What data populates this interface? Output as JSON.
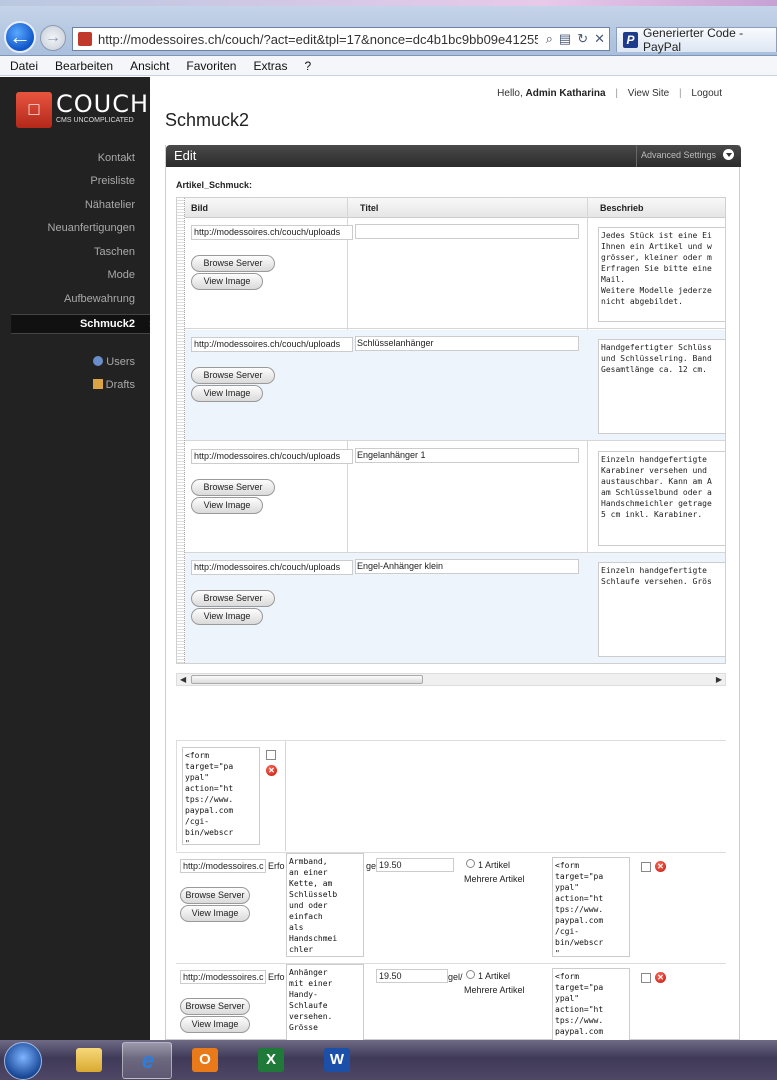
{
  "browser": {
    "url": "http://modessoires.ch/couch/?act=edit&tpl=17&nonce=dc4b1bc9bb09e41255a06",
    "tab_title": "Generierter Code - PayPal",
    "menu": [
      "Datei",
      "Bearbeiten",
      "Ansicht",
      "Favoriten",
      "Extras",
      "?"
    ]
  },
  "logo": {
    "word": "COUCH",
    "tagline": "CMS UNCOMPLICATED"
  },
  "header": {
    "hello_prefix": "Hello,",
    "user": "Admin Katharina",
    "view_site": "View Site",
    "logout": "Logout"
  },
  "sidebar": {
    "items": [
      "Kontakt",
      "Preisliste",
      "Nähatelier",
      "Neuanfertigungen",
      "Taschen",
      "Mode",
      "Aufbewahrung"
    ],
    "active": "Schmuck2",
    "admin": [
      "Users",
      "Drafts"
    ]
  },
  "page": {
    "title": "Schmuck2",
    "panel_label": "Edit",
    "advanced_settings": "Advanced Settings",
    "field_label": "Artikel_Schmuck:"
  },
  "table": {
    "columns": [
      "Bild",
      "Titel",
      "Beschrieb"
    ],
    "browse_label": "Browse Server",
    "view_label": "View Image",
    "rows": [
      {
        "url": "http://modessoires.ch/couch/uploads",
        "title": "",
        "desc": "Jedes Stück ist eine Ei\nIhnen ein Artikel und w\ngrösser, kleiner oder m\nErfragen Sie bitte eine\nMail.\nWeitere Modelle jederze\nnicht abgebildet."
      },
      {
        "url": "http://modessoires.ch/couch/uploads",
        "title": "Schlüsselanhänger",
        "desc": "Handgefertigter Schlüss\nund Schlüsselring. Band\nGesamtlänge ca. 12 cm."
      },
      {
        "url": "http://modessoires.ch/couch/uploads",
        "title": "Engelanhänger 1",
        "desc": "Einzeln handgefertigte\nKarabiner versehen und\naustauschbar. Kann am A\nam Schlüsselbund oder a\nHandschmeichler getrage\n5 cm inkl. Karabiner."
      },
      {
        "url": "http://modessoires.ch/couch/uploads",
        "title": "Engel-Anhänger klein",
        "desc": "Einzeln handgefertigte\nSchlaufe versehen. Grös"
      }
    ]
  },
  "lower": {
    "code_top": "<form\ntarget=\"pa\nypal\"\naction=\"ht\ntps://www.\npaypal.com\n/cgi-\nbin/webscr\n\"",
    "rows": [
      {
        "url": "http://modessoires.c",
        "desc_prefix": "Erfo",
        "desc": "Armband,\nan einer\nKette, am\nSchlüsselb\nund oder\neinfach\nals\nHandschmei\nchler",
        "after": "ge/",
        "price": "19.50",
        "radio1": "1 Artikel",
        "radio2": "Mehrere Artikel",
        "code": "<form\ntarget=\"pa\nypal\"\naction=\"ht\ntps://www.\npaypal.com\n/cgi-\nbin/webscr\n\"",
        "browse": "Browse Server",
        "view": "View Image"
      },
      {
        "url": "http://modessoires.c",
        "desc_prefix": "Erfo",
        "desc": "Anhänger\nmit einer\nHandy-\nSchlaufe\nversehen.\nGrösse",
        "after": "gel/",
        "price": "19.50",
        "radio1": "1 Artikel",
        "radio2": "Mehrere Artikel",
        "code": "<form\ntarget=\"pa\nypal\"\naction=\"ht\ntps://www.\npaypal.com",
        "browse": "Browse Server",
        "view": "View Image"
      }
    ]
  },
  "taskbar": {
    "apps": [
      "explorer-icon",
      "internet-explorer-icon",
      "outlook-icon",
      "excel-icon",
      "word-icon"
    ]
  }
}
